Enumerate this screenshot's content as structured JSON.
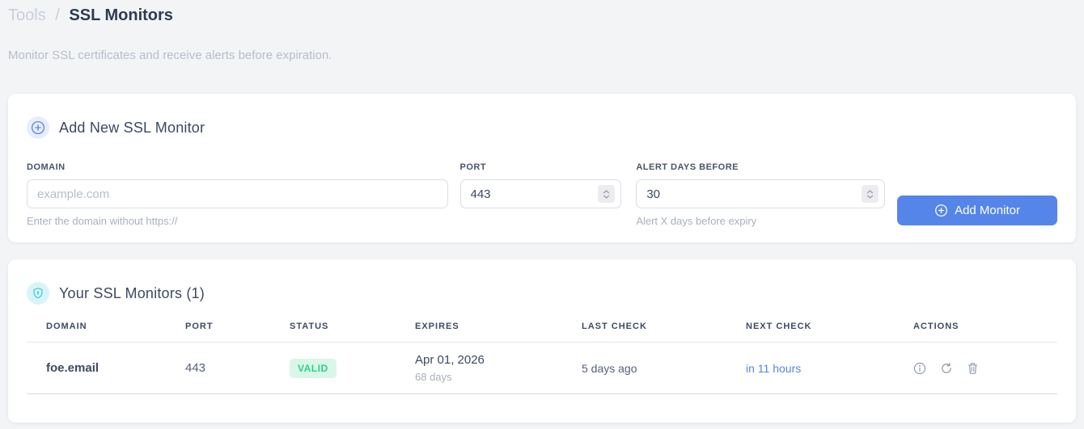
{
  "page": {
    "breadcrumb": {
      "section": "Tools",
      "separator": "/",
      "current": "SSL Monitors"
    },
    "subtitle": "Monitor SSL certificates and receive alerts before expiration."
  },
  "add_monitor_card": {
    "title": "Add New SSL Monitor",
    "fields": {
      "domain": {
        "label": "DOMAIN",
        "placeholder": "example.com",
        "value": "",
        "helper": "Enter the domain without https://"
      },
      "port": {
        "label": "PORT",
        "value": "443"
      },
      "alert_days": {
        "label": "ALERT DAYS BEFORE",
        "value": "30",
        "helper": "Alert X days before expiry"
      }
    },
    "submit_label": "Add Monitor"
  },
  "monitors_card": {
    "title": "Your SSL Monitors (1)",
    "table": {
      "headers": [
        "DOMAIN",
        "PORT",
        "STATUS",
        "EXPIRES",
        "LAST CHECK",
        "NEXT CHECK",
        "ACTIONS"
      ],
      "rows": [
        {
          "domain": "foe.email",
          "port": "443",
          "status": "VALID",
          "expires_date": "Apr 01, 2026",
          "expires_relative": "68 days",
          "last_check": "5 days ago",
          "next_check": "in 11 hours"
        }
      ]
    }
  },
  "colors": {
    "accent_blue": "#5585e8",
    "icon_cyan": "#2ec5d8",
    "badge_green_bg": "#d8f7e8",
    "badge_green_text": "#2ed184",
    "page_background": "#f3f4f6"
  }
}
